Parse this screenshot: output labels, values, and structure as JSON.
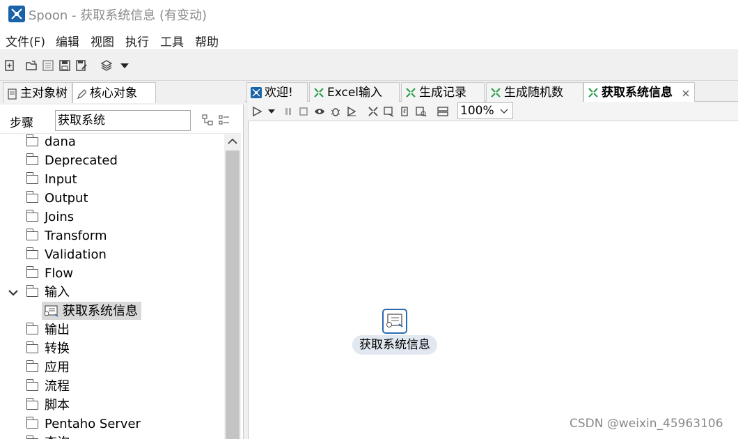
{
  "window": {
    "title": "Spoon - 获取系统信息 (有变动)"
  },
  "menu": [
    "文件(F)",
    "编辑",
    "视图",
    "执行",
    "工具",
    "帮助"
  ],
  "left_tabs": [
    {
      "label": "主对象树",
      "icon": "document-icon"
    },
    {
      "label": "核心对象",
      "icon": "pencil-icon"
    }
  ],
  "steps": {
    "label": "步骤",
    "search_value": "获取系统"
  },
  "tree": [
    {
      "label": "dana",
      "type": "folder"
    },
    {
      "label": "Deprecated",
      "type": "folder"
    },
    {
      "label": "Input",
      "type": "folder"
    },
    {
      "label": "Output",
      "type": "folder"
    },
    {
      "label": "Joins",
      "type": "folder"
    },
    {
      "label": "Transform",
      "type": "folder"
    },
    {
      "label": "Validation",
      "type": "folder"
    },
    {
      "label": "Flow",
      "type": "folder"
    },
    {
      "label": "输入",
      "type": "folder",
      "expanded": true
    },
    {
      "label": "获取系统信息",
      "type": "step",
      "selected": true
    },
    {
      "label": "输出",
      "type": "folder"
    },
    {
      "label": "转换",
      "type": "folder"
    },
    {
      "label": "应用",
      "type": "folder"
    },
    {
      "label": "流程",
      "type": "folder"
    },
    {
      "label": "脚本",
      "type": "folder"
    },
    {
      "label": "Pentaho Server",
      "type": "folder"
    },
    {
      "label": "查询",
      "type": "folder"
    }
  ],
  "editor_tabs": [
    {
      "label": "欢迎!",
      "icon": "spoon-icon"
    },
    {
      "label": "Excel输入",
      "icon": "transformation-icon"
    },
    {
      "label": "生成记录",
      "icon": "transformation-icon"
    },
    {
      "label": "生成随机数",
      "icon": "transformation-icon"
    },
    {
      "label": "获取系统信息",
      "icon": "transformation-icon",
      "active": true
    }
  ],
  "zoom": "100%",
  "canvas": {
    "step_label": "获取系统信息"
  },
  "watermark": "CSDN @weixin_45963106",
  "colors": {
    "accent": "#2a6bb3",
    "tab_icon": "#2e9e4a"
  }
}
